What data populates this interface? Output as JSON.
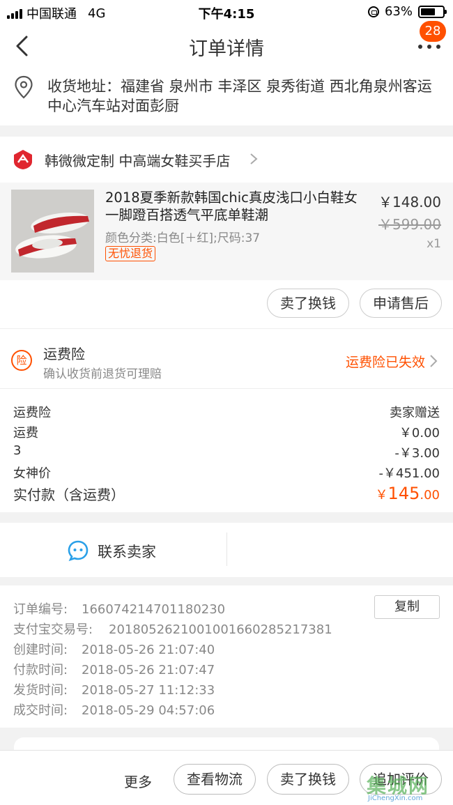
{
  "status_bar": {
    "carrier": "中国联通",
    "network": "4G",
    "time": "下午4:15",
    "battery": "63%"
  },
  "navbar": {
    "title": "订单详情",
    "badge_count": "28"
  },
  "address": {
    "text": "收货地址：福建省 泉州市 丰泽区 泉秀街道 西北角泉州客运中心汽车站对面彭厨"
  },
  "shop": {
    "name": "韩微微定制 中高端女鞋买手店",
    "item": {
      "title": "2018夏季新款韩国chic真皮浅口小白鞋女一脚蹬百搭透气平底单鞋潮",
      "spec": "颜色分类:白色[＋红];尺码:37",
      "tag": "无忧退货",
      "price": "￥148.00",
      "original_price": "￥599.00",
      "quantity": "x1"
    },
    "actions": {
      "sell": "卖了换钱",
      "after_sale": "申请售后"
    }
  },
  "insurance": {
    "title": "运费险",
    "subtitle": "确认收货前退货可理赔",
    "status": "运费险已失效"
  },
  "fees": {
    "rows": [
      {
        "label": "运费险",
        "value": "卖家赠送"
      },
      {
        "label": "运费",
        "value": "￥0.00"
      },
      {
        "label": "3",
        "value": "-￥3.00"
      },
      {
        "label": "女神价",
        "value": "-￥451.00"
      }
    ],
    "total_label": "实付款（含运费）",
    "total_currency": "￥",
    "total_int": "145",
    "total_dec": ".00"
  },
  "contact": {
    "label": "联系卖家"
  },
  "order_info": {
    "copy_label": "复制",
    "rows": [
      {
        "label": "订单编号:",
        "value": "166074214701180230"
      },
      {
        "label": "支付宝交易号:",
        "value": "2018052621001001660285217381"
      },
      {
        "label": "创建时间:",
        "value": "2018-05-26 21:07:40"
      },
      {
        "label": "付款时间:",
        "value": "2018-05-26 21:07:47"
      },
      {
        "label": "发货时间:",
        "value": "2018-05-27 11:12:33"
      },
      {
        "label": "成交时间:",
        "value": "2018-05-29 04:57:06"
      }
    ]
  },
  "bottom_bar": {
    "more": "更多",
    "logistics": "查看物流",
    "sell": "卖了换钱",
    "review": "追加评价"
  },
  "watermark": {
    "logo": "集城网",
    "site": "JiChengXin.com"
  },
  "colors": {
    "accent": "#ff5000",
    "shop_icon": "#e0262f",
    "contact_icon": "#2aa0e8"
  }
}
